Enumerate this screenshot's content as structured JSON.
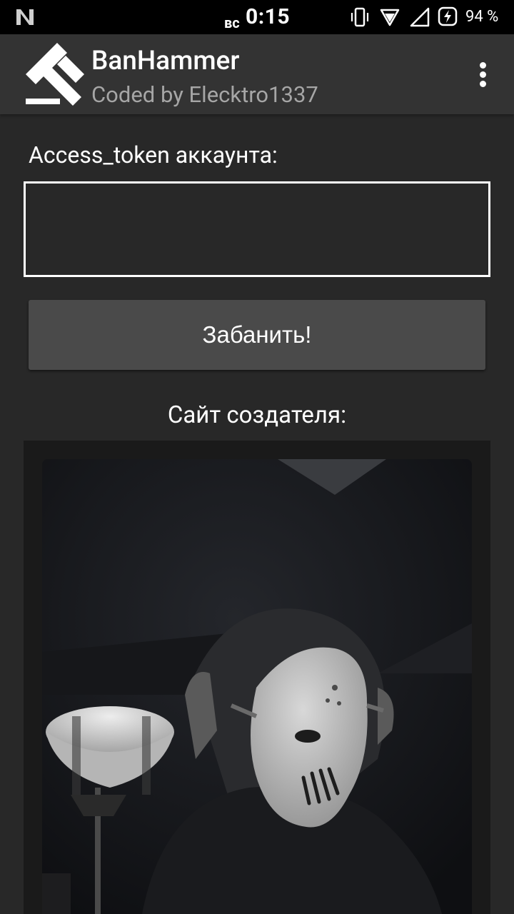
{
  "status_bar": {
    "day": "вс",
    "time": "0:15",
    "battery": "94 %"
  },
  "app_bar": {
    "title": "BanHammer",
    "subtitle": "Coded by Elecktro1337"
  },
  "form": {
    "token_label": "Access_token аккаунта:",
    "token_value": "",
    "ban_button_label": "Забанить!"
  },
  "creator": {
    "label": "Сайт создателя:"
  },
  "colors": {
    "background": "#282828",
    "app_bar": "#333333",
    "button": "#4a4a4a",
    "subtitle": "#a6a6a6"
  },
  "icons": {
    "status_left": "n-notification-icon",
    "vibrate": "vibrate-icon",
    "wifi": "wifi-icon",
    "signal": "signal-icon",
    "battery": "battery-charging-icon",
    "logo": "banhammer-logo-icon",
    "menu": "more-vert-icon"
  }
}
